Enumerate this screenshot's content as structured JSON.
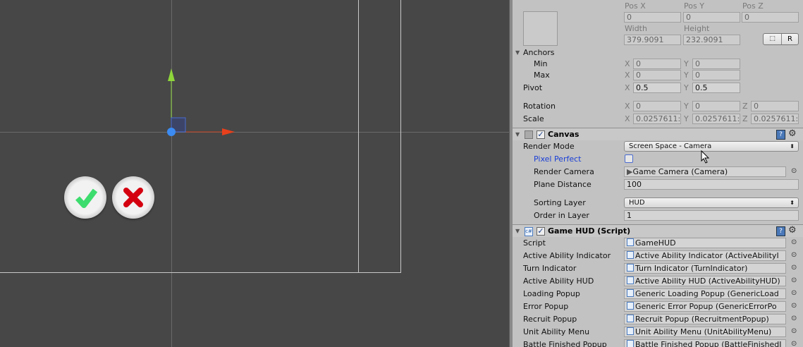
{
  "colors": {
    "scene_bg": "#474747",
    "inspector_bg": "#c2c2c2",
    "x_axis": "#e8401c",
    "y_axis": "#8fd63a",
    "pivot": "#3b8bf2",
    "link": "#1a3fd6"
  },
  "rect_transform": {
    "pos_labels": [
      "Pos X",
      "Pos Y",
      "Pos Z"
    ],
    "pos_values": [
      "0",
      "0",
      "0"
    ],
    "width_label": "Width",
    "height_label": "Height",
    "width": "379.9091",
    "height": "232.9091",
    "blueprint_button": "⬚",
    "raw_button": "R",
    "anchors_label": "Anchors",
    "min_label": "Min",
    "max_label": "Max",
    "min": {
      "x": "0",
      "y": "0"
    },
    "max": {
      "x": "0",
      "y": "0"
    },
    "pivot_label": "Pivot",
    "pivot": {
      "x": "0.5",
      "y": "0.5"
    },
    "rotation_label": "Rotation",
    "rotation": {
      "x": "0",
      "y": "0",
      "z": "0"
    },
    "scale_label": "Scale",
    "scale": {
      "x": "0.0257611:",
      "y": "0.0257611:",
      "z": "0.0257611:"
    },
    "axis": {
      "x": "X",
      "y": "Y",
      "z": "Z"
    }
  },
  "canvas": {
    "title": "Canvas",
    "enabled": true,
    "render_mode_label": "Render Mode",
    "render_mode": "Screen Space - Camera",
    "pixel_perfect_label": "Pixel Perfect",
    "pixel_perfect": false,
    "render_camera_label": "Render Camera",
    "render_camera": "Game Camera (Camera)",
    "plane_distance_label": "Plane Distance",
    "plane_distance": "100",
    "sorting_layer_label": "Sorting Layer",
    "sorting_layer": "HUD",
    "order_label": "Order in Layer",
    "order": "1"
  },
  "game_hud": {
    "title": "Game HUD (Script)",
    "enabled": true,
    "fields": [
      {
        "label": "Script",
        "value": "GameHUD"
      },
      {
        "label": "Active Ability Indicator",
        "value": "Active Ability Indicator (ActiveAbilityI"
      },
      {
        "label": "Turn Indicator",
        "value": "Turn Indicator (TurnIndicator)"
      },
      {
        "label": "Active Ability HUD",
        "value": "Active Ability HUD (ActiveAbilityHUD)"
      },
      {
        "label": "Loading Popup",
        "value": "Generic Loading Popup (GenericLoad"
      },
      {
        "label": "Error Popup",
        "value": "Generic Error Popup (GenericErrorPo"
      },
      {
        "label": "Recruit Popup",
        "value": "Recruit Popup (RecruitmentPopup)"
      },
      {
        "label": "Unit Ability Menu",
        "value": "Unit Ability Menu (UnitAbilityMenu)"
      },
      {
        "label": "Battle Finished Popup",
        "value": "Battle Finished Popup (BattleFinishedI"
      }
    ]
  },
  "icons": {
    "help": "?",
    "gear": "⚙",
    "picker": "⊙",
    "triangle": "▼",
    "check": "✓",
    "script": "c#"
  }
}
